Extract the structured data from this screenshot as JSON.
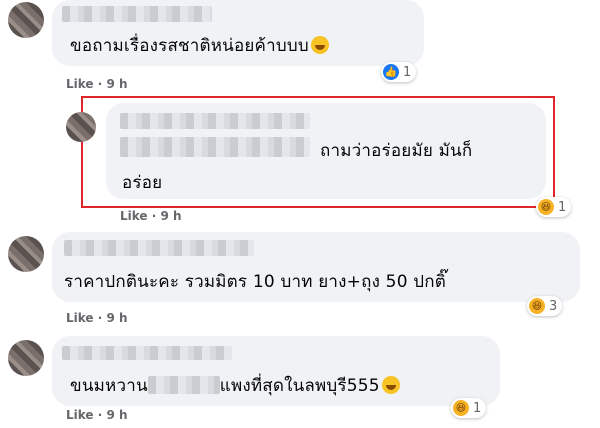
{
  "comments": [
    {
      "text": "ขอถามเรื่องรสชาติหน่อยค้าบบบ",
      "emoji": "grinning-sweat-emoji",
      "meta": {
        "like": "Like",
        "time": "9 h"
      },
      "reaction": {
        "icon": "like",
        "count": "1"
      }
    },
    {
      "text_line1": "ถามว่าอร่อยมัย มันก็",
      "text_line2": "อร่อย",
      "meta": {
        "like": "Like",
        "time": "9 h"
      },
      "reaction": {
        "icon": "haha",
        "count": "1"
      },
      "highlight_color": "#e0252b"
    },
    {
      "text": "ราคาปกตินะคะ รวมมิตร 10 บาท ยาง+ถุง 50 ปกติ๊",
      "meta": {
        "like": "Like",
        "time": "9 h"
      },
      "reaction": {
        "icon": "haha",
        "count": "3"
      }
    },
    {
      "text_before": "ขนมหวาน",
      "text_after": "แพงที่สุดในลพบุรี555",
      "emoji": "rofl-emoji",
      "meta": {
        "like": "Like",
        "time": "9 h"
      },
      "reaction": {
        "icon": "haha",
        "count": "1"
      }
    }
  ],
  "colors": {
    "bubble": "#f0f2f5",
    "meta": "#65676b",
    "like_blue": "#1877f2",
    "haha_yellow": "#f7b125"
  }
}
